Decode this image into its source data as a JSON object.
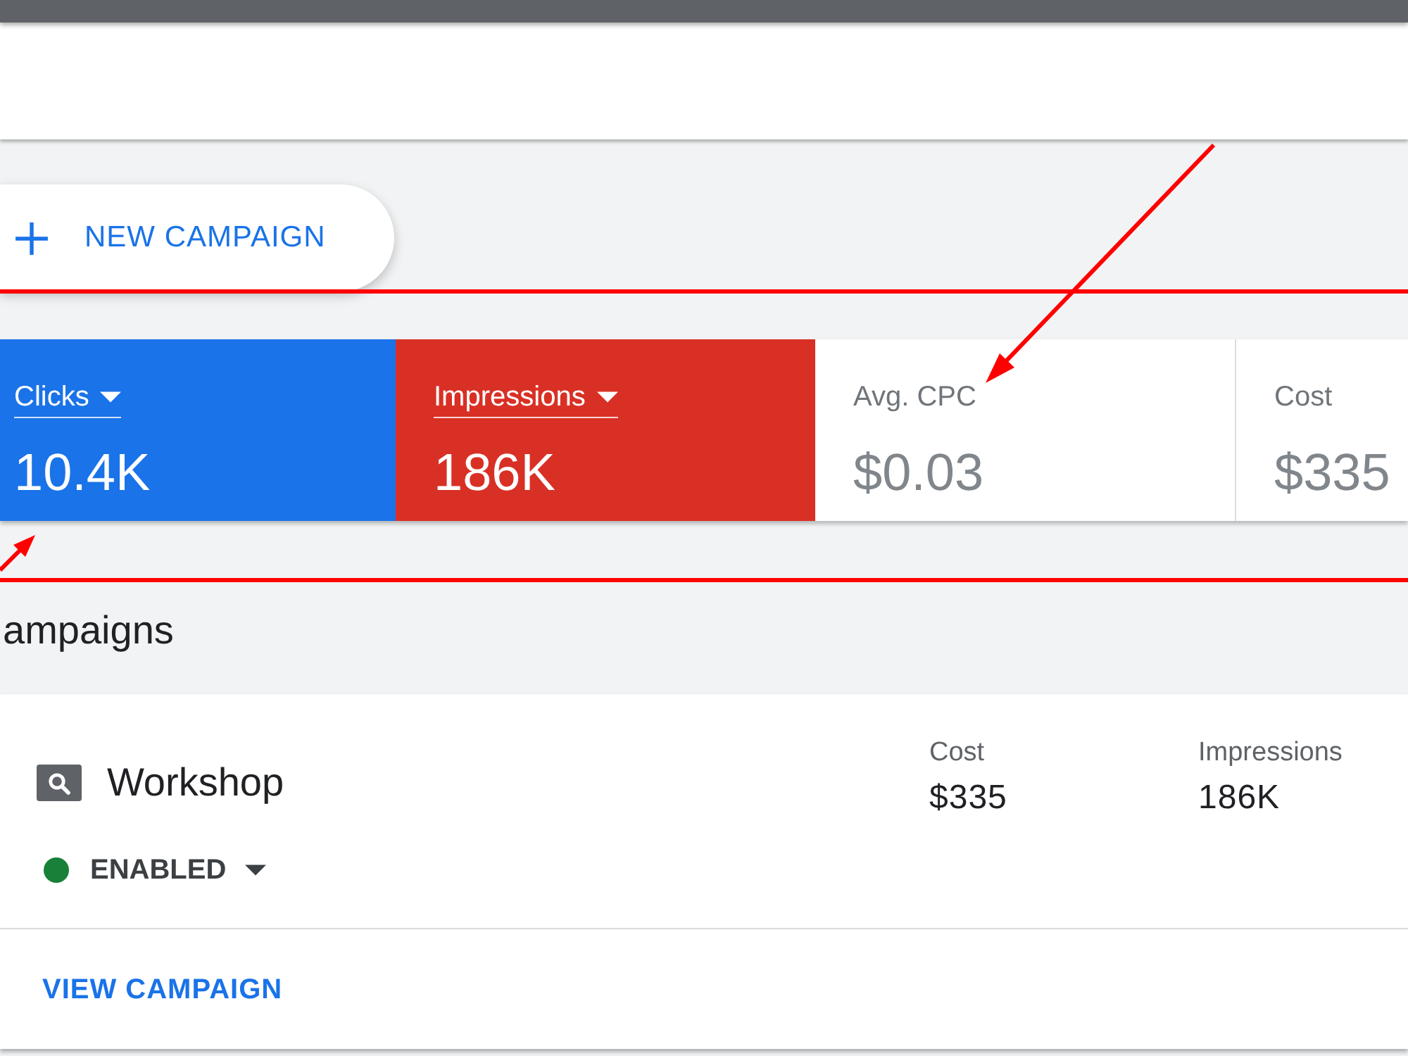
{
  "new_campaign_button": {
    "label": "NEW CAMPAIGN"
  },
  "metrics": [
    {
      "label": "Clicks",
      "value": "10.4K",
      "selected": true,
      "color": "#1a73e8"
    },
    {
      "label": "Impressions",
      "value": "186K",
      "selected": true,
      "color": "#d93025"
    },
    {
      "label": "Avg. CPC",
      "value": "$0.03",
      "selected": false
    },
    {
      "label": "Cost",
      "value": "$335",
      "selected": false
    }
  ],
  "section_title": "ampaigns",
  "campaign": {
    "name": "Workshop",
    "status": {
      "label": "ENABLED",
      "color": "#188038"
    },
    "stats": [
      {
        "label": "Cost",
        "value": "$335"
      },
      {
        "label": "Impressions",
        "value": "186K"
      }
    ],
    "action": "VIEW CAMPAIGN"
  }
}
